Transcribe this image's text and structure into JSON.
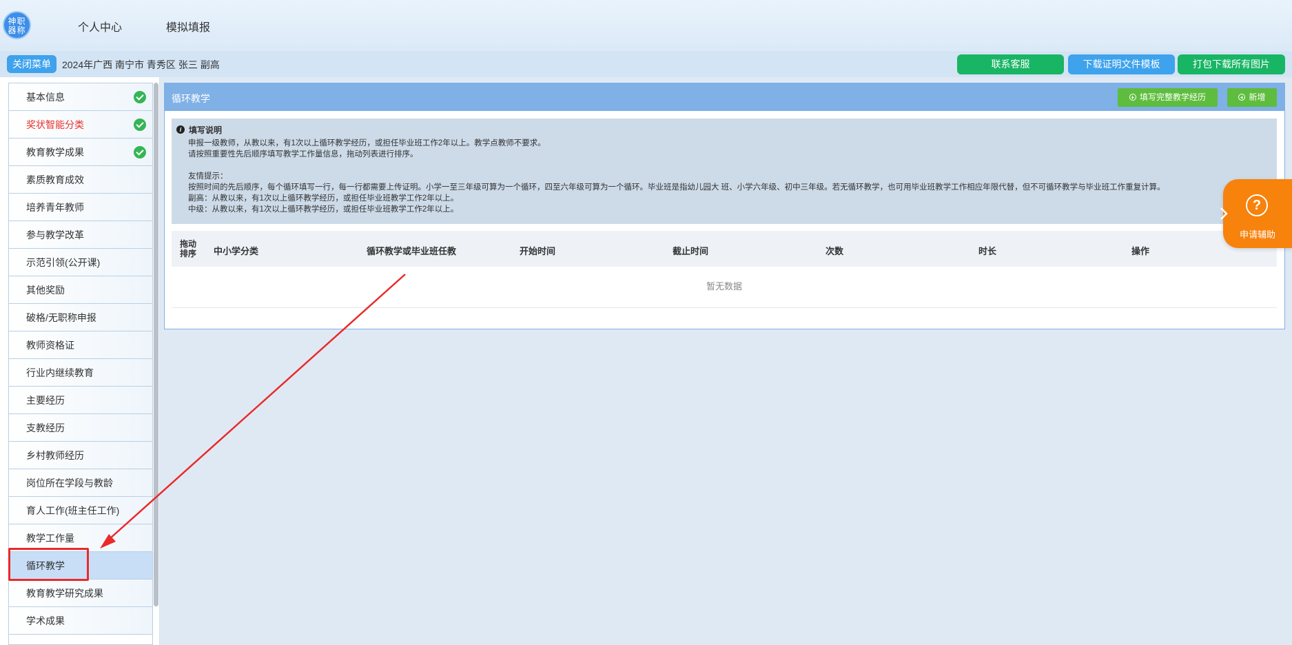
{
  "header": {
    "logo_text": "神职器称",
    "nav": [
      "个人中心",
      "模拟填报"
    ]
  },
  "subbar": {
    "close_menu": "关闭菜单",
    "breadcrumb": "2024年广西 南宁市 青秀区 张三 副高",
    "buttons": [
      "联系客服",
      "下载证明文件模板",
      "打包下载所有图片"
    ],
    "colors": {
      "green": "#18b565",
      "blue": "#3ea2ec"
    }
  },
  "sidebar": {
    "items": [
      {
        "label": "基本信息",
        "done": true
      },
      {
        "label": "奖状智能分类",
        "done": true,
        "red": true
      },
      {
        "label": "教育教学成果",
        "done": true
      },
      {
        "label": "素质教育成效"
      },
      {
        "label": "培养青年教师"
      },
      {
        "label": "参与教学改革"
      },
      {
        "label": "示范引领(公开课)"
      },
      {
        "label": "其他奖励"
      },
      {
        "label": "破格/无职称申报"
      },
      {
        "label": "教师资格证"
      },
      {
        "label": "行业内继续教育"
      },
      {
        "label": "主要经历"
      },
      {
        "label": "支教经历"
      },
      {
        "label": "乡村教师经历"
      },
      {
        "label": "岗位所在学段与教龄"
      },
      {
        "label": "育人工作(班主任工作)"
      },
      {
        "label": "教学工作量"
      },
      {
        "label": "循环教学",
        "active": true
      },
      {
        "label": "教育教学研究成果"
      },
      {
        "label": "学术成果"
      }
    ]
  },
  "panel": {
    "title": "循环教学",
    "btn_fill": "填写完整教学经历",
    "btn_add": "新增",
    "notice": {
      "title": "填写说明",
      "lines": [
        "申报一级教师，从教以来，有1次以上循环教学经历，或担任毕业班工作2年以上。教学点教师不要求。",
        "请按照重要性先后顺序填写教学工作量信息，拖动列表进行排序。",
        "",
        "友情提示：",
        "按照时间的先后顺序，每个循环填写一行，每一行都需要上传证明。小学一至三年级可算为一个循环，四至六年级可算为一个循环。毕业班是指幼儿园大 班、小学六年级、初中三年级。若无循环教学，也可用毕业班教学工作相应年限代替，但不可循环教学与毕业班工作重复计算。",
        "副高：从教以来，有1次以上循环教学经历，或担任毕业班教学工作2年以上。",
        "中级：从教以来，有1次以上循环教学经历，或担任毕业班教学工作2年以上。"
      ]
    },
    "table": {
      "sort_col": [
        "拖动",
        "排序"
      ],
      "columns": [
        "中小学分类",
        "循环教学或毕业班任教",
        "开始时间",
        "截止时间",
        "次数",
        "时长",
        "操作"
      ],
      "empty": "暂无数据"
    }
  },
  "help": {
    "label": "申请辅助",
    "icon": "question-icon"
  }
}
